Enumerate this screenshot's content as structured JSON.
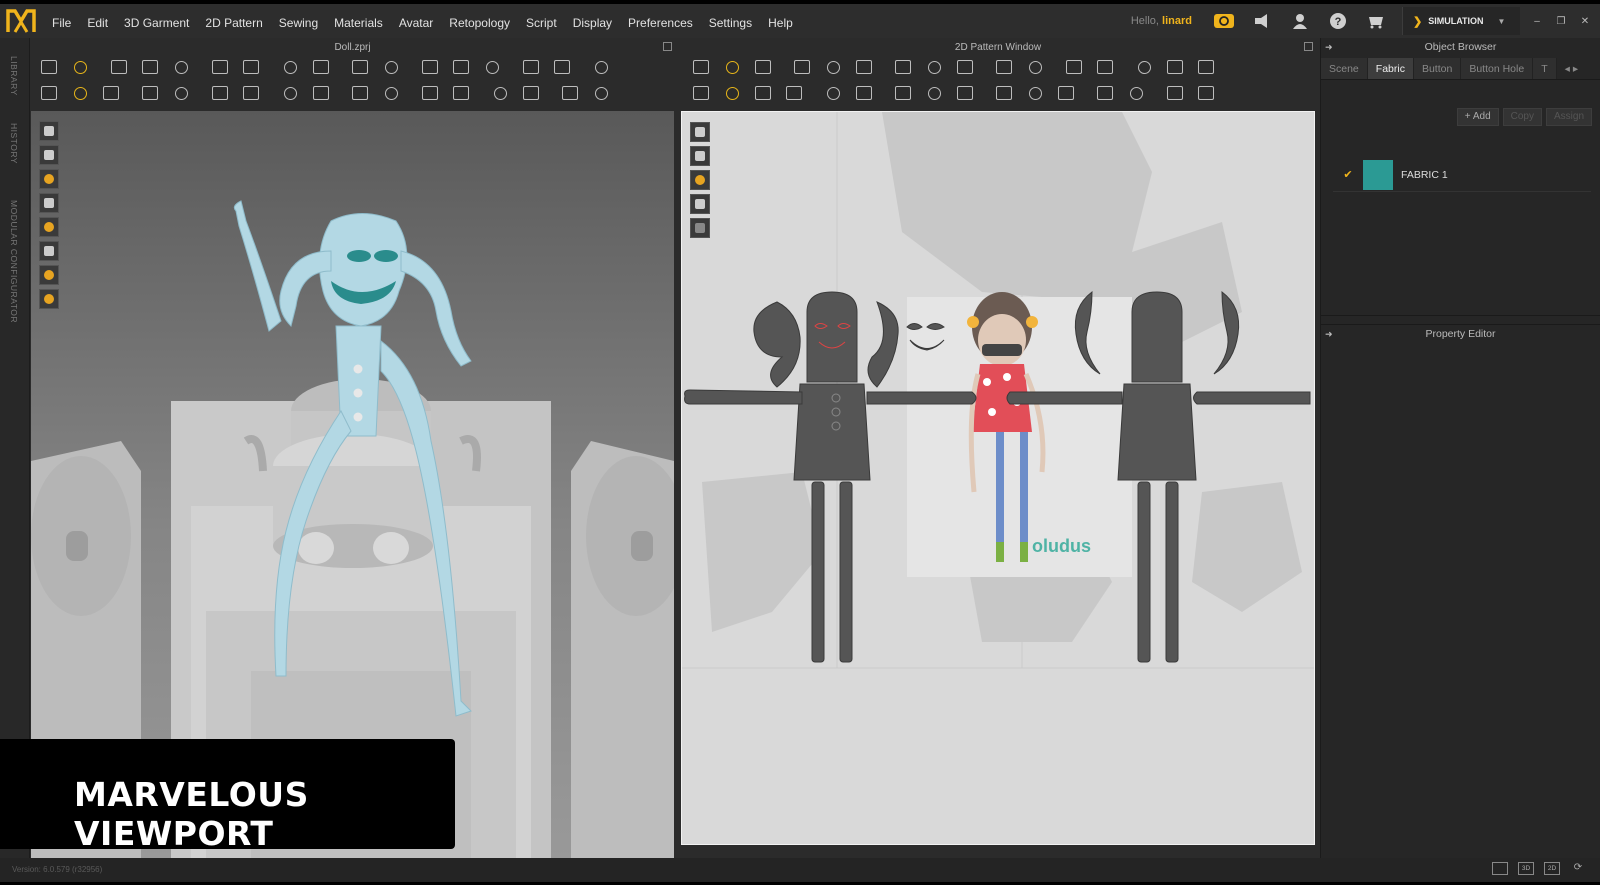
{
  "app": {
    "menu": [
      "File",
      "Edit",
      "3D Garment",
      "2D Pattern",
      "Sewing",
      "Materials",
      "Avatar",
      "Retopology",
      "Script",
      "Display",
      "Preferences",
      "Settings",
      "Help"
    ],
    "greeting_prefix": "Hello,",
    "username": "linard",
    "mode_label": "SIMULATION",
    "accent_color": "#f0b41c",
    "window_controls": [
      "–",
      "❐",
      "✕"
    ]
  },
  "left_tabs": [
    "LIBRARY",
    "HISTORY",
    "MODULAR CONFIGURATOR"
  ],
  "viewport3d": {
    "title": "Doll.zprj"
  },
  "pattern_window": {
    "title": "2D Pattern Window",
    "logo_text": "oludus"
  },
  "object_browser": {
    "title": "Object Browser",
    "tabs": [
      "Scene",
      "Fabric",
      "Button",
      "Button Hole",
      "T"
    ],
    "active_tab": "Fabric",
    "buttons": {
      "add": "+ Add",
      "copy": "Copy",
      "assign": "Assign"
    },
    "fabrics": [
      {
        "name": "FABRIC 1",
        "color": "#2b9a94",
        "checked": true
      }
    ]
  },
  "property_editor": {
    "title": "Property Editor"
  },
  "status": {
    "version": "Version: 6.0.579 (r32956)",
    "view_buttons": [
      "",
      "3D",
      "2D",
      "⟳"
    ]
  },
  "caption": {
    "text": "MARVELOUS VIEWPORT"
  }
}
